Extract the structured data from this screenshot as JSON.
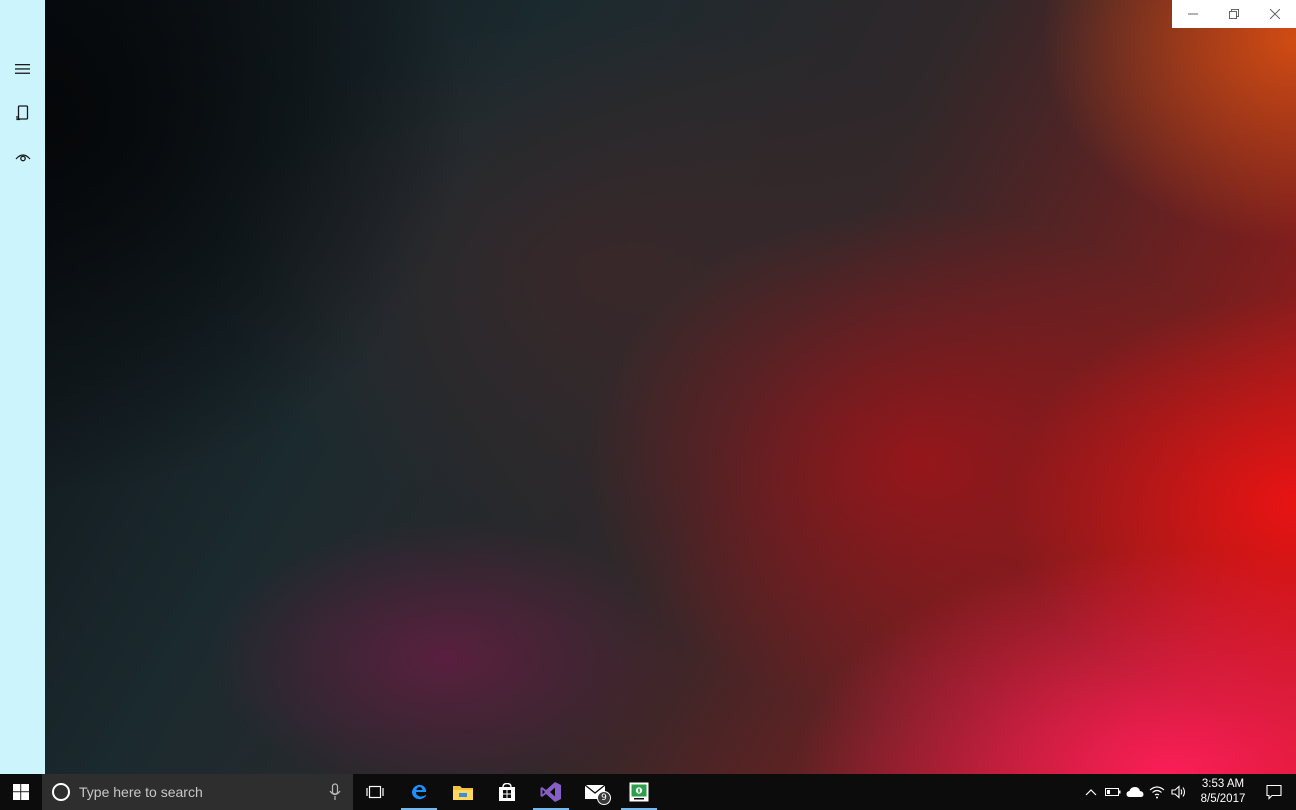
{
  "window": {
    "nav": {
      "items": [
        {
          "icon": "hamburger-menu-icon"
        },
        {
          "icon": "device-rotate-icon"
        },
        {
          "icon": "eye-view-icon"
        }
      ]
    },
    "caption_buttons": [
      {
        "icon": "minimize-icon"
      },
      {
        "icon": "restore-icon"
      },
      {
        "icon": "close-icon"
      }
    ]
  },
  "taskbar": {
    "search": {
      "placeholder": "Type here to search"
    },
    "apps": [
      {
        "icon": "task-view-icon",
        "active": false
      },
      {
        "icon": "edge-browser-icon",
        "active": true
      },
      {
        "icon": "file-explorer-icon",
        "active": false
      },
      {
        "icon": "store-icon",
        "active": false
      },
      {
        "icon": "visual-studio-icon",
        "active": true
      },
      {
        "icon": "mail-icon",
        "active": false,
        "badge": "9"
      },
      {
        "icon": "green-app-icon",
        "active": true
      }
    ],
    "tray": {
      "icons": [
        "show-hidden-icons-chevron",
        "battery-icon",
        "onedrive-cloud-icon",
        "wifi-icon",
        "volume-icon"
      ],
      "time": "3:53 AM",
      "date": "8/5/2017"
    }
  },
  "colors": {
    "nav_background": "#ccf4fc",
    "taskbar_background": "#0c0c0c",
    "search_background": "#2e2e2e",
    "active_indicator": "#76b9ed",
    "visual_studio_purple": "#865fc5",
    "edge_blue": "#1e90ff",
    "green_app": "#2e9e4a"
  }
}
